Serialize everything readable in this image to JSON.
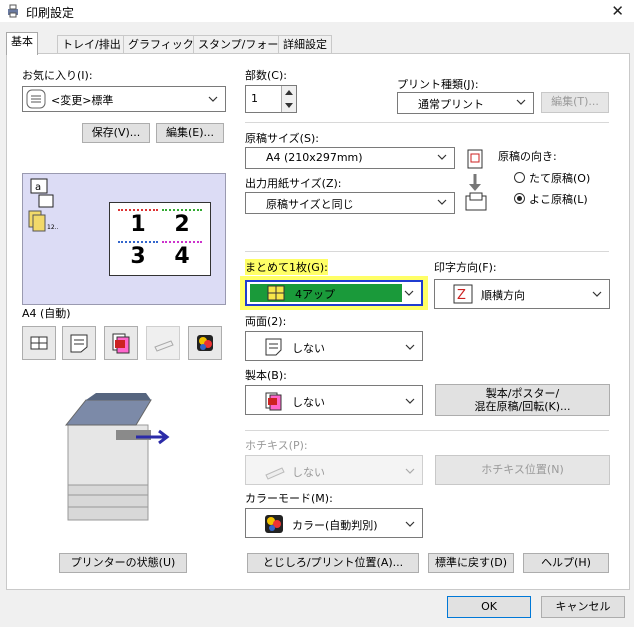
{
  "window": {
    "title": "印刷設定",
    "close": "✕"
  },
  "tabs": [
    {
      "label": "基本"
    },
    {
      "label": "トレイ/排出"
    },
    {
      "label": "グラフィックス"
    },
    {
      "label": "スタンプ/フォーム"
    },
    {
      "label": "詳細設定"
    }
  ],
  "favorites": {
    "label": "お気に入り(I):",
    "value": "<変更>標準",
    "save": "保存(V)...",
    "edit": "編集(E)..."
  },
  "preview": {
    "paper_label": "A4 (自動)",
    "pages": [
      "1",
      "2",
      "3",
      "4"
    ]
  },
  "copies": {
    "label": "部数(C):",
    "value": "1"
  },
  "print_type": {
    "label": "プリント種類(J):",
    "value": "通常プリント",
    "edit": "編集(T)..."
  },
  "original_size": {
    "label": "原稿サイズ(S):",
    "value": "A4 (210x297mm)"
  },
  "output_size": {
    "label": "出力用紙サイズ(Z):",
    "value": "原稿サイズと同じ"
  },
  "orientation": {
    "label": "原稿の向き:",
    "portrait": "たて原稿(O)",
    "landscape": "よこ原稿(L)",
    "selected": "landscape"
  },
  "nup": {
    "label": "まとめて1枚(G):",
    "value": "4アップ"
  },
  "print_direction": {
    "label": "印字方向(F):",
    "value": "順横方向"
  },
  "duplex": {
    "label": "両面(2):",
    "value": "しない"
  },
  "booklet": {
    "label": "製本(B):",
    "value": "しない",
    "button_line1": "製本/ポスター/",
    "button_line2": "混在原稿/回転(K)..."
  },
  "staple": {
    "label": "ホチキス(P):",
    "value": "しない",
    "button": "ホチキス位置(N)"
  },
  "color_mode": {
    "label": "カラーモード(M):",
    "value": "カラー(自動判別)"
  },
  "bottom": {
    "printer_status": "プリンターの状態(U)",
    "binding": "とじしろ/プリント位置(A)...",
    "reset": "標準に戻す(D)",
    "help": "ヘルプ(H)"
  },
  "footer": {
    "ok": "OK",
    "cancel": "キャンセル"
  },
  "colors": {
    "accent": "#0078d7",
    "highlight": "#ffff66",
    "nup_fill": "#1a9a3a",
    "nup_border": "#1f3cd0",
    "preview_bg": "#dcdcf5"
  }
}
